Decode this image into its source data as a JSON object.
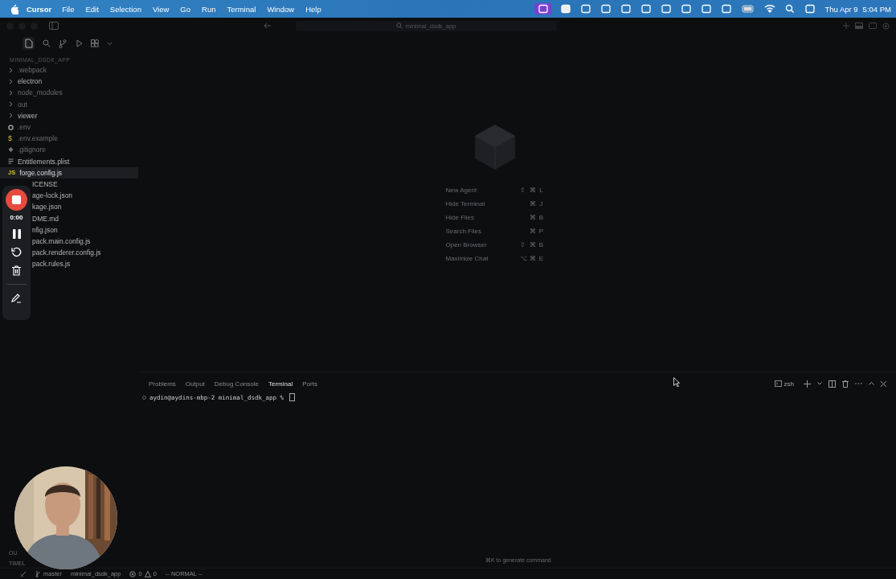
{
  "menubar": {
    "app": "Cursor",
    "menus": [
      "File",
      "Edit",
      "Selection",
      "View",
      "Go",
      "Run",
      "Terminal",
      "Window",
      "Help"
    ],
    "date": "Thu Apr 9",
    "time": "5:04 PM"
  },
  "titlebar": {
    "search": "minimal_dsdk_app"
  },
  "explorer": {
    "title": "MINIMAL_DSDK_APP",
    "items": [
      {
        "kind": "folder",
        "name": ".webpack",
        "expanded": false,
        "ignored": true,
        "selected": false
      },
      {
        "kind": "folder",
        "name": "electron",
        "expanded": false,
        "ignored": false,
        "selected": false
      },
      {
        "kind": "folder",
        "name": "node_modules",
        "expanded": false,
        "ignored": true,
        "selected": false
      },
      {
        "kind": "folder",
        "name": "out",
        "expanded": false,
        "ignored": true,
        "selected": false
      },
      {
        "kind": "folder",
        "name": "viewer",
        "expanded": false,
        "ignored": false,
        "selected": false
      },
      {
        "kind": "gear",
        "name": ".env",
        "ignored": true,
        "selected": false
      },
      {
        "kind": "dollar",
        "icon": "$",
        "name": ".env.example",
        "ignored": true,
        "selected": false
      },
      {
        "kind": "dot",
        "name": ".gitignore",
        "ignored": true,
        "selected": false
      },
      {
        "kind": "lines",
        "name": "Entitlements.plist",
        "ignored": false,
        "selected": false
      },
      {
        "kind": "js",
        "icon": "JS",
        "name": "forge.config.js",
        "ignored": false,
        "selected": true
      },
      {
        "kind": "partial",
        "name": "ICENSE",
        "ignored": false,
        "selected": false
      },
      {
        "kind": "partial",
        "name": "age-lock.json",
        "ignored": false,
        "selected": false
      },
      {
        "kind": "partial",
        "name": "kage.json",
        "ignored": false,
        "selected": false
      },
      {
        "kind": "partial",
        "name": "DME.md",
        "ignored": false,
        "selected": false
      },
      {
        "kind": "partial",
        "name": "nfig.json",
        "ignored": false,
        "selected": false
      },
      {
        "kind": "partial",
        "name": "pack.main.config.js",
        "ignored": false,
        "selected": false
      },
      {
        "kind": "partial",
        "name": "pack.renderer.config.js",
        "ignored": false,
        "selected": false
      },
      {
        "kind": "partial",
        "name": "pack.rules.js",
        "ignored": false,
        "selected": false
      }
    ],
    "sections": [
      "OU",
      "TIMEL"
    ]
  },
  "recorder": {
    "time": "0:00"
  },
  "shortcuts": [
    {
      "label": "New Agent",
      "keys": [
        "⇧",
        "⌘",
        "L"
      ]
    },
    {
      "label": "Hide Terminal",
      "keys": [
        "⌘",
        "J"
      ]
    },
    {
      "label": "Hide Files",
      "keys": [
        "⌘",
        "B"
      ]
    },
    {
      "label": "Search Files",
      "keys": [
        "⌘",
        "P"
      ]
    },
    {
      "label": "Open Browser",
      "keys": [
        "⇧",
        "⌘",
        "B"
      ]
    },
    {
      "label": "Maximize Chat",
      "keys": [
        "⌥",
        "⌘",
        "E"
      ]
    }
  ],
  "panel": {
    "tabs": [
      {
        "label": "Problems",
        "selected": false
      },
      {
        "label": "Output",
        "selected": false
      },
      {
        "label": "Debug Console",
        "selected": false
      },
      {
        "label": "Terminal",
        "selected": true
      },
      {
        "label": "Ports",
        "selected": false
      }
    ],
    "shell": "zsh",
    "prompt": "aydin@aydins-mbp-2 minimal_dsdk_app % ",
    "hint": "⌘K to generate command"
  },
  "status": {
    "branch": "master",
    "workspace": "minimal_dsdk_app",
    "errors": "0",
    "warnings": "0",
    "mode": "-- NORMAL --"
  }
}
